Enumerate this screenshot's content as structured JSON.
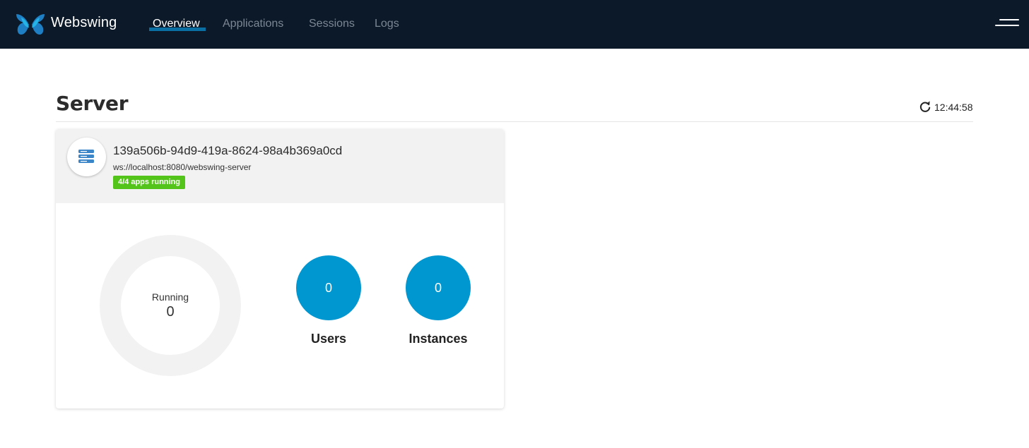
{
  "app": {
    "brand": "Webswing"
  },
  "nav": {
    "links": [
      {
        "label": "Overview",
        "active": true
      },
      {
        "label": "Applications",
        "active": false
      },
      {
        "label": "Sessions",
        "active": false
      },
      {
        "label": "Logs",
        "active": false
      }
    ],
    "menu_icon": "hamburger-icon"
  },
  "page": {
    "title": "Server",
    "refresh_icon": "refresh-icon",
    "last_refresh": "12:44:58"
  },
  "server": {
    "icon": "server-stack-icon",
    "id": "139a506b-94d9-419a-8624-98a4b369a0cd",
    "url": "ws://localhost:8080/webswing-server",
    "status": "4/4 apps running",
    "running_label": "Running",
    "running_count": "0",
    "stats": [
      {
        "label": "Users",
        "value": "0"
      },
      {
        "label": "Instances",
        "value": "0"
      }
    ]
  },
  "colors": {
    "navbar": "#0c1928",
    "accent": "#0096cf",
    "status_green": "#52c41a"
  }
}
